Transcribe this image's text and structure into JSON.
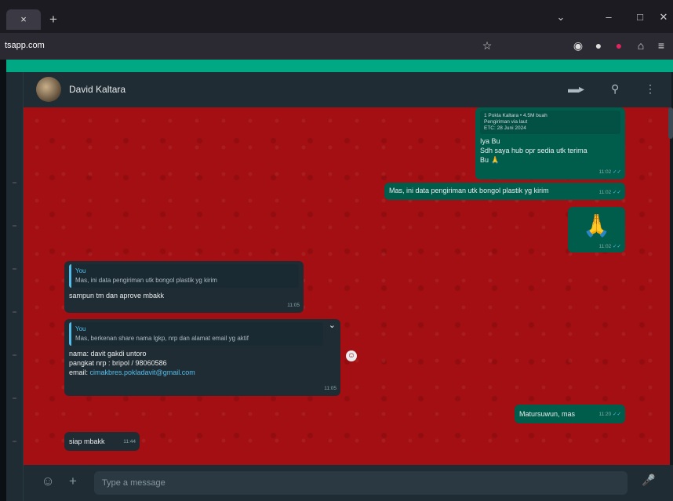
{
  "browser": {
    "tab_close": "×",
    "new_tab": "+",
    "url": "tsapp.com",
    "controls": {
      "dropdown": "⌄",
      "minimize": "–",
      "restore": "□",
      "close": "✕"
    }
  },
  "chat": {
    "contact_name": "David Kaltara",
    "video_icon": "▬▸",
    "search_icon": "⚲",
    "menu_icon": "⋮"
  },
  "messages": {
    "m1": {
      "forward_lines": [
        "1 Pokla Kaltara • 4.5M buah",
        "Pengiriman via laut",
        "ETC: 28 Juni 2024"
      ],
      "text_line1": "Iya Bu",
      "text_line2": "Sdh saya hub opr sedia utk terima",
      "text_line3": "Bu 🙏",
      "time": "11:02"
    },
    "m2": {
      "text": "Mas, ini data pengiriman utk bongol plastik yg kirim",
      "time": "11:02"
    },
    "m3": {
      "emoji": "🙏",
      "time": "11:02"
    },
    "m4": {
      "quote_name": "You",
      "quote_text": "Mas, ini data pengiriman utk bongol plastik yg kirim",
      "text": "sampun tm dan aprove mbakk",
      "time": "11:05"
    },
    "m5": {
      "quote_name": "You",
      "quote_text": "Mas, berkenan share nama lgkp, nrp dan alamat email yg aktif",
      "line1": "nama: davit gakdi untoro",
      "line2": "pangkat nrp : bripol / 98060586",
      "line3_label": "email: ",
      "line3_link": "cimakbres.pokladavit@gmail.com",
      "time": "11:05"
    },
    "m6": {
      "text": "Matursuwun, mas",
      "time": "11:20"
    },
    "m7": {
      "text": "siap mbakk",
      "time": "11:44"
    }
  },
  "composer": {
    "emoji_icon": "☺",
    "attach_icon": "+",
    "placeholder": "Type a message",
    "mic_icon": "🎤"
  },
  "colors": {
    "chat_background": "#a30f12",
    "outgoing_bubble": "#005c4b",
    "incoming_bubble": "#202c33",
    "accent": "#00a884"
  }
}
